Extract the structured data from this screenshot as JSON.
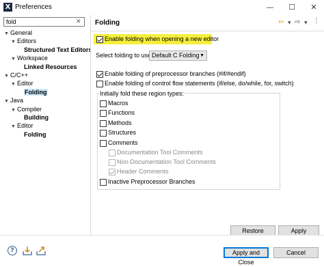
{
  "window": {
    "title": "Preferences",
    "minimize": "—",
    "maximize": "☐",
    "close": "✕"
  },
  "filter": {
    "value": "fold",
    "clear_glyph": "✕"
  },
  "tree": [
    {
      "label": "General",
      "indent": 0,
      "expanded": true
    },
    {
      "label": "Editors",
      "indent": 1,
      "expanded": true
    },
    {
      "label": "Structured Text Editors",
      "indent": 2,
      "bold": true
    },
    {
      "label": "Workspace",
      "indent": 1,
      "expanded": true
    },
    {
      "label": "Linked Resources",
      "indent": 2,
      "bold": true
    },
    {
      "label": "C/C++",
      "indent": 0,
      "expanded": true
    },
    {
      "label": "Editor",
      "indent": 1,
      "expanded": true
    },
    {
      "label": "Folding",
      "indent": 2,
      "bold": true,
      "selected": true
    },
    {
      "label": "Java",
      "indent": 0,
      "expanded": true
    },
    {
      "label": "Compiler",
      "indent": 1,
      "expanded": true
    },
    {
      "label": "Building",
      "indent": 2,
      "bold": true
    },
    {
      "label": "Editor",
      "indent": 1,
      "expanded": true
    },
    {
      "label": "Folding",
      "indent": 2,
      "bold": true
    }
  ],
  "page": {
    "title": "Folding",
    "enable_folding": "Enable folding when opening a new editor",
    "select_label": "Select folding to use:",
    "select_value": "Default C Folding",
    "preproc": "Enable folding of preprocessor branches (#if/#endif)",
    "control_flow": "Enable folding of control flow statements (if/else, do/while, for, switch)",
    "group_label": "Initially fold these region types:",
    "regions": {
      "macros": "Macros",
      "functions": "Functions",
      "methods": "Methods",
      "structures": "Structures",
      "comments": "Comments",
      "doc_tool": "Documentation Tool Comments",
      "non_doc_tool": "Non-Documentation Tool Comments",
      "header": "Header Comments",
      "inactive": "Inactive Preprocessor Branches"
    },
    "restore_defaults": "Restore Defaults",
    "apply": "Apply"
  },
  "footer": {
    "apply_close": "Apply and Close",
    "cancel": "Cancel",
    "help_icon": "?"
  },
  "colors": {
    "highlight": "#f5ef3e",
    "selection": "#cde8ff",
    "nav_arrow": "#d99a00"
  }
}
